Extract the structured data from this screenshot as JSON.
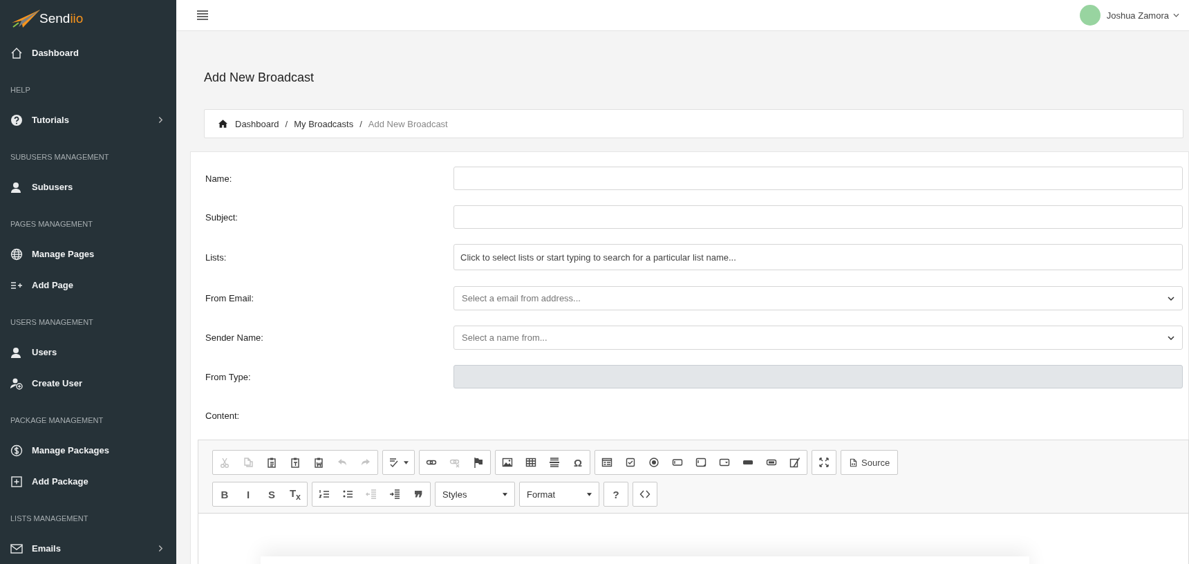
{
  "sidebar": {
    "logo": {
      "text": "Send",
      "accent": "iio"
    },
    "items": [
      {
        "kind": "item",
        "label": "Dashboard",
        "submenu": false
      },
      {
        "kind": "section",
        "label": "HELP"
      },
      {
        "kind": "item",
        "label": "Tutorials",
        "submenu": true
      },
      {
        "kind": "section",
        "label": "SUBUSERS MANAGEMENT"
      },
      {
        "kind": "item",
        "label": "Subusers",
        "submenu": false
      },
      {
        "kind": "section",
        "label": "PAGES MANAGEMENT"
      },
      {
        "kind": "item",
        "label": "Manage Pages",
        "submenu": false
      },
      {
        "kind": "item",
        "label": "Add Page",
        "submenu": false
      },
      {
        "kind": "section",
        "label": "USERS MANAGEMENT"
      },
      {
        "kind": "item",
        "label": "Users",
        "submenu": false
      },
      {
        "kind": "item",
        "label": "Create User",
        "submenu": false
      },
      {
        "kind": "section",
        "label": "PACKAGE MANAGEMENT"
      },
      {
        "kind": "item",
        "label": "Manage Packages",
        "submenu": false
      },
      {
        "kind": "item",
        "label": "Add Package",
        "submenu": false
      },
      {
        "kind": "section",
        "label": "LISTS MANAGEMENT"
      },
      {
        "kind": "item",
        "label": "Emails",
        "submenu": true
      }
    ]
  },
  "topbar": {
    "user": "Joshua Zamora"
  },
  "page_title": "Add New Broadcast",
  "breadcrumb": [
    {
      "label": "Dashboard",
      "current": false
    },
    {
      "sep": "/",
      "label": "My Broadcasts",
      "current": false
    },
    {
      "sep": "/",
      "label": "Add New Broadcast",
      "current": true
    }
  ],
  "form": {
    "fields": [
      {
        "label": "Name:",
        "kind": "input",
        "disabled": false
      },
      {
        "label": "Subject:",
        "kind": "input",
        "disabled": false
      },
      {
        "label": "Lists:",
        "kind": "tags",
        "placeholder": "Click to select lists or start typing to search for a particular list name...",
        "disabled": false
      },
      {
        "label": "From Email:",
        "kind": "select",
        "placeholder": "Select a email from address...",
        "disabled": false
      },
      {
        "label": "Sender Name:",
        "kind": "select",
        "placeholder": "Select a name from...",
        "disabled": false
      },
      {
        "label": "From Type:",
        "kind": "input",
        "disabled": true
      }
    ],
    "content_label": "Content:"
  },
  "toolbar": {
    "rows": [
      [
        [
          {
            "kind": "icon",
            "disabled": true
          },
          {
            "kind": "icon",
            "disabled": true
          },
          {
            "kind": "icon",
            "disabled": false
          },
          {
            "kind": "icon",
            "disabled": false
          },
          {
            "kind": "icon",
            "disabled": false
          },
          {
            "kind": "icon",
            "disabled": true
          },
          {
            "kind": "icon",
            "disabled": true
          }
        ],
        [
          {
            "kind": "icon-dropdown",
            "disabled": false
          }
        ],
        [
          {
            "kind": "icon",
            "disabled": false
          },
          {
            "kind": "icon",
            "disabled": true
          },
          {
            "kind": "icon",
            "disabled": false
          }
        ],
        [
          {
            "kind": "icon",
            "disabled": false
          },
          {
            "kind": "icon",
            "disabled": false
          },
          {
            "kind": "icon",
            "disabled": false
          },
          {
            "kind": "glyph",
            "label": "Ω",
            "disabled": false
          }
        ],
        [
          {
            "kind": "icon",
            "disabled": false
          },
          {
            "kind": "icon",
            "disabled": false
          },
          {
            "kind": "icon",
            "disabled": false
          },
          {
            "kind": "icon",
            "disabled": false
          },
          {
            "kind": "icon",
            "disabled": false
          },
          {
            "kind": "icon",
            "disabled": false
          },
          {
            "kind": "icon",
            "disabled": false
          },
          {
            "kind": "icon",
            "disabled": false
          },
          {
            "kind": "icon",
            "disabled": false
          }
        ],
        [
          {
            "kind": "icon",
            "disabled": false
          }
        ],
        [
          {
            "kind": "icon-text",
            "label": "Source",
            "disabled": false
          }
        ]
      ],
      [
        [
          {
            "kind": "glyph",
            "label": "B",
            "disabled": false
          },
          {
            "kind": "glyph",
            "label": "I",
            "disabled": false
          },
          {
            "kind": "glyph",
            "label": "S",
            "disabled": false
          },
          {
            "kind": "glyph",
            "label": "T$_{x}$",
            "disabled": false
          }
        ],
        [
          {
            "kind": "icon",
            "disabled": false
          },
          {
            "kind": "icon",
            "disabled": false
          },
          {
            "kind": "icon",
            "disabled": true
          },
          {
            "kind": "icon",
            "disabled": false
          },
          {
            "kind": "glyph",
            "label": "❞",
            "disabled": false
          }
        ],
        [
          {
            "kind": "dropdown",
            "label": "Styles",
            "disabled": false
          }
        ],
        [
          {
            "kind": "dropdown",
            "label": "Format",
            "disabled": false
          }
        ],
        [
          {
            "kind": "glyph",
            "label": "?",
            "disabled": false
          }
        ],
        [
          {
            "kind": "icon",
            "disabled": false
          }
        ]
      ]
    ]
  }
}
